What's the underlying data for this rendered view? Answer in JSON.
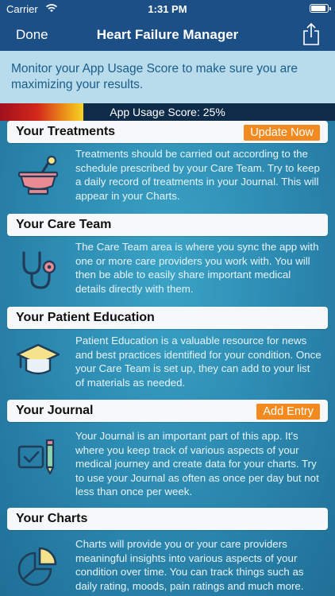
{
  "status": {
    "carrier": "Carrier",
    "time": "1:31 PM"
  },
  "nav": {
    "done_label": "Done",
    "title": "Heart Failure Manager"
  },
  "banner": {
    "text": "Monitor your App Usage Score to make sure you are maximizing your results."
  },
  "score": {
    "label": "App Usage Score: 25%",
    "value_percent": 25
  },
  "sections": [
    {
      "title": "Your Treatments",
      "action": "Update Now",
      "icon": "mortar-pestle-icon",
      "text": "Treatments should be carried out according to the schedule prescribed by your Care Team. Try to keep a daily record of treatments in your Journal. This will appear in your Charts."
    },
    {
      "title": "Your Care Team",
      "icon": "stethoscope-icon",
      "text": "The Care Team area is where you sync the app with one or more care providers you work with. You will then be able to easily share important medical details directly with them."
    },
    {
      "title": "Your Patient Education",
      "icon": "graduation-cap-icon",
      "text": "Patient Education is a valuable resource for news and best practices identified for your condition. Once your Care Team is set up, they can add to your list of materials as needed."
    },
    {
      "title": "Your Journal",
      "action": "Add Entry",
      "icon": "journal-pencil-icon",
      "text": "Your Journal is an important part of this app. It's where you keep track of various aspects of your medical journey and create data for your charts. Try to use your Journal as often as once per day but not less than once per week."
    },
    {
      "title": "Your Charts",
      "icon": "pie-chart-icon",
      "text": "Charts will provide you or your care providers meaningful insights into various aspects of your condition over time. You can track things such as daily rating, moods, pain ratings and much more."
    }
  ],
  "colors": {
    "nav_bg": "#1b4f86",
    "banner_bg": "#b8dcec",
    "action_button": "#f38a1f",
    "icon_pink": "#e98b92",
    "icon_yellow": "#f4e38a"
  }
}
